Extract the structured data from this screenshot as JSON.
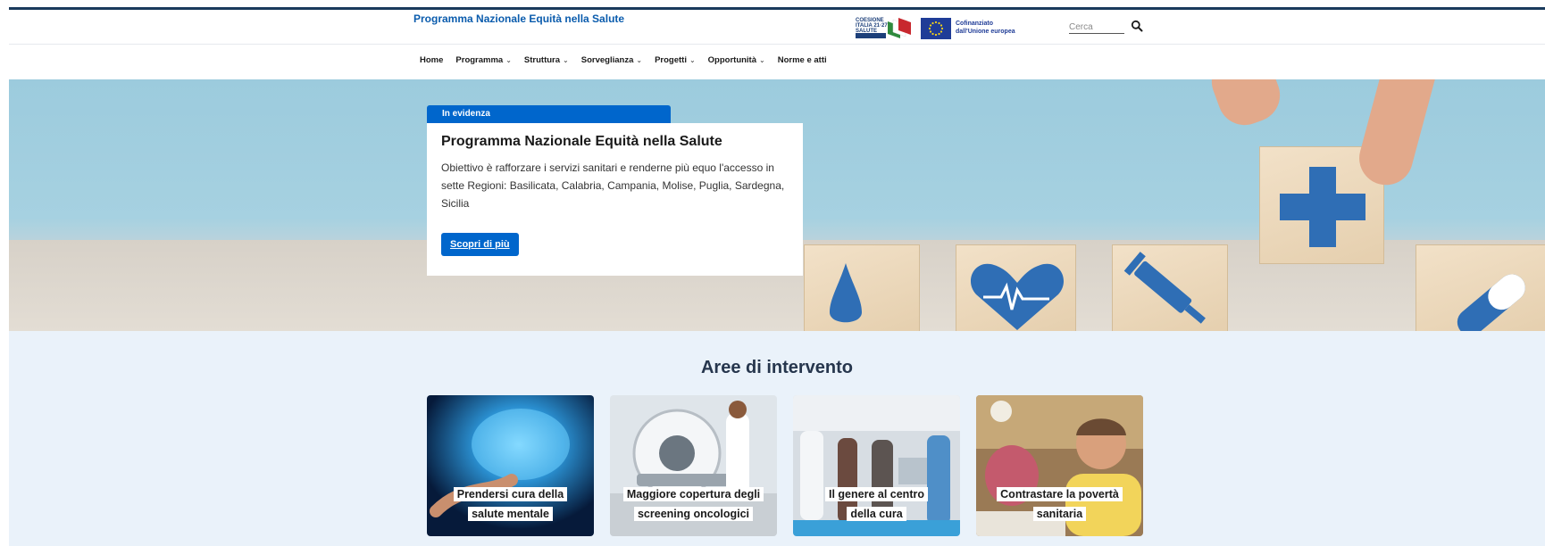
{
  "header": {
    "site_title": "Programma Nazionale Equità nella Salute",
    "coesione_logo_text": "COESIONE\nITALIA 21-27\nSALUTE",
    "eu_logo_text_line1": "Cofinanziato",
    "eu_logo_text_line2": "dall'Unione europea",
    "search": {
      "placeholder": "Cerca",
      "value": ""
    }
  },
  "nav": {
    "items": [
      {
        "label": "Home",
        "has_dropdown": false
      },
      {
        "label": "Programma",
        "has_dropdown": true
      },
      {
        "label": "Struttura",
        "has_dropdown": true
      },
      {
        "label": "Sorveglianza",
        "has_dropdown": true
      },
      {
        "label": "Progetti",
        "has_dropdown": true
      },
      {
        "label": "Opportunità",
        "has_dropdown": true
      },
      {
        "label": "Norme e atti",
        "has_dropdown": false
      }
    ],
    "dropdown_caret": "⌄"
  },
  "hero": {
    "tag": "In evidenza",
    "title": "Programma Nazionale Equità nella Salute",
    "description": "Obiettivo è rafforzare i servizi sanitari e renderne più equo l'accesso in sette Regioni: Basilicata, Calabria, Campania, Molise, Puglia, Sardegna, Sicilia",
    "cta_label": "Scopri di più"
  },
  "areas": {
    "title": "Aree di intervento",
    "cards": [
      {
        "label_line1": "Prendersi cura della",
        "label_line2": "salute mentale",
        "image": "brain-hologram-photo"
      },
      {
        "label_line1": "Maggiore copertura degli",
        "label_line2": "screening oncologici",
        "image": "ct-scanner-photo"
      },
      {
        "label_line1": "Il genere al centro",
        "label_line2": "della cura",
        "image": "hospital-reception-photo"
      },
      {
        "label_line1": "Contrastare la povertà",
        "label_line2": "sanitaria",
        "image": "smiling-woman-photo"
      }
    ]
  },
  "colors": {
    "primary": "#0066cc",
    "title_blue": "#0b5cad",
    "dark_navy": "#1a3a5c",
    "section_bg": "#eaf2fa",
    "cross_blue": "#2f6eb5"
  },
  "icons": {
    "search": "search-icon",
    "caret": "chevron-down-icon"
  }
}
